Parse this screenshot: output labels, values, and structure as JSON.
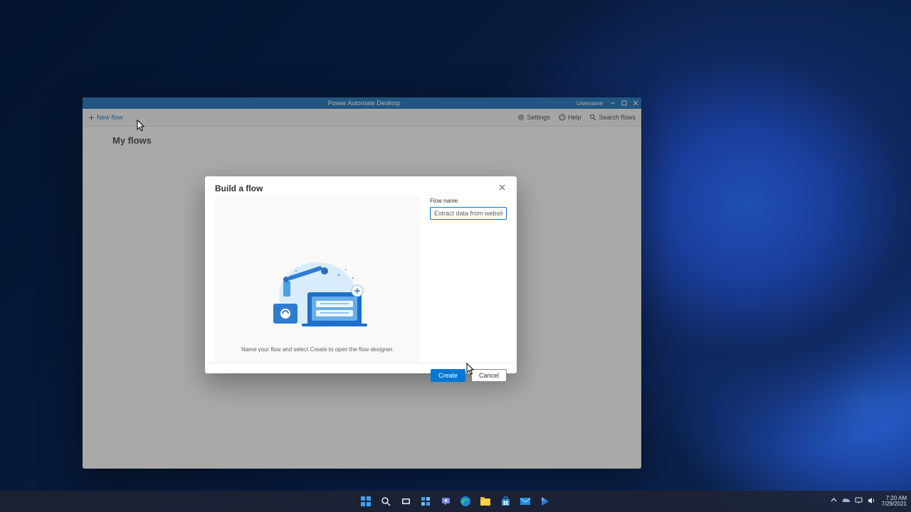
{
  "window": {
    "title": "Power Automate Desktop",
    "username": "Username"
  },
  "commandbar": {
    "new_flow": "New flow",
    "settings": "Settings",
    "help": "Help",
    "search": "Search flows"
  },
  "page": {
    "heading": "My flows"
  },
  "dialog": {
    "title": "Build a flow",
    "flow_name_label": "Flow name",
    "flow_name_value": "Extract data from website",
    "caption": "Name your flow and select Create to open the flow designer.",
    "create": "Create",
    "cancel": "Cancel"
  },
  "taskbar": {
    "time": "7:20 AM",
    "date": "7/29/2021"
  }
}
